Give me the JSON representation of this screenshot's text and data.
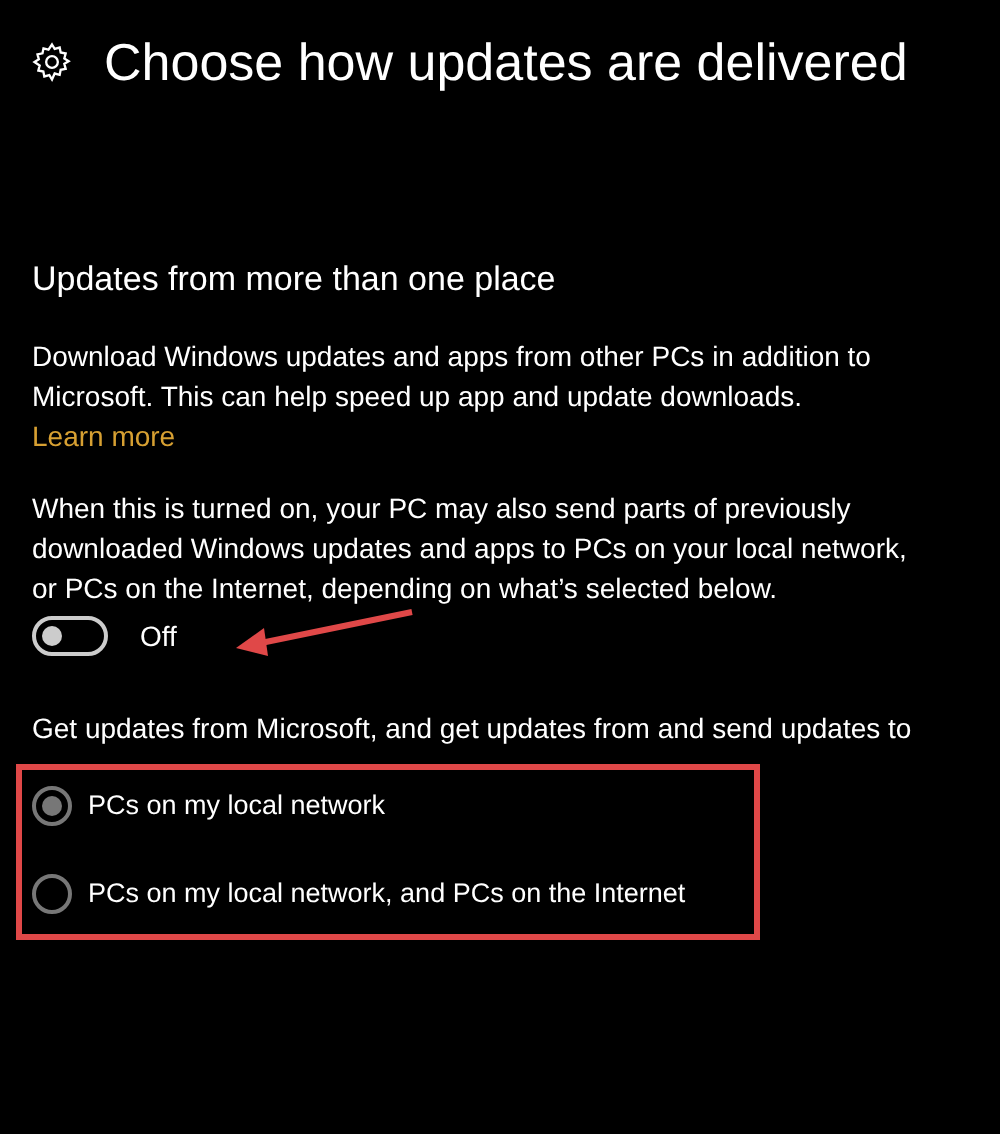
{
  "title": "Choose how updates are delivered",
  "section": {
    "heading": "Updates from more than one place",
    "description": "Download Windows updates and apps from other PCs in addition to Microsoft. This can help speed up app and update downloads.",
    "link": "Learn more",
    "explanation": "When this is turned on, your PC may also send parts of previously downloaded Windows updates and apps to PCs on your local network, or PCs on the Internet, depending on what’s selected below.",
    "toggle": {
      "on": false,
      "label": "Off"
    },
    "options_prompt": "Get updates from Microsoft, and get updates from and send updates to",
    "options": [
      {
        "label": "PCs on my local network",
        "selected": true
      },
      {
        "label": "PCs on my local network, and PCs on the Internet",
        "selected": false
      }
    ]
  }
}
